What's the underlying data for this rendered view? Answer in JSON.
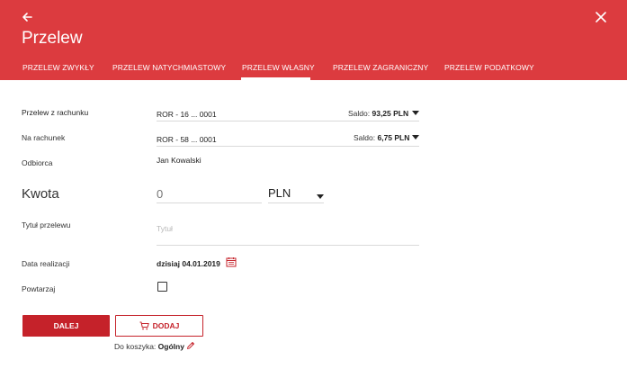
{
  "header": {
    "title": "Przelew",
    "back_icon": "arrow-left-icon",
    "close_icon": "close-icon",
    "background_color": "#dc3b3f"
  },
  "tabs": [
    {
      "label": "PRZELEW ZWYKŁY",
      "active": false
    },
    {
      "label": "PRZELEW NATYCHMIASTOWY",
      "active": false
    },
    {
      "label": "PRZELEW WŁASNY",
      "active": true
    },
    {
      "label": "PRZELEW ZAGRANICZNY",
      "active": false
    },
    {
      "label": "PRZELEW PODATKOWY",
      "active": false
    }
  ],
  "form": {
    "from_account": {
      "label": "Przelew z rachunku",
      "value": "ROR - 16 ... 0001",
      "saldo_label": "Saldo:",
      "saldo_value": "93,25 PLN"
    },
    "to_account": {
      "label": "Na rachunek",
      "value": "ROR - 58 ... 0001",
      "saldo_label": "Saldo:",
      "saldo_value": "6,75 PLN"
    },
    "recipient": {
      "label": "Odbiorca",
      "value": "Jan Kowalski"
    },
    "amount": {
      "label": "Kwota",
      "placeholder": "0",
      "currency": "PLN"
    },
    "transfer_title": {
      "label": "Tytuł przelewu",
      "placeholder": "Tytuł"
    },
    "execution_date": {
      "label": "Data realizacji",
      "value": "dzisiaj 04.01.2019",
      "icon": "calendar-icon"
    },
    "repeat": {
      "label": "Powtarzaj",
      "checked": false
    }
  },
  "actions": {
    "next_label": "DALEJ",
    "add_label": "DODAJ",
    "add_icon": "cart-icon",
    "basket_prefix": "Do koszyka:",
    "basket_name": "Ogólny",
    "edit_icon": "pencil-icon"
  },
  "colors": {
    "accent": "#c5222a",
    "header": "#dc3b3f"
  }
}
